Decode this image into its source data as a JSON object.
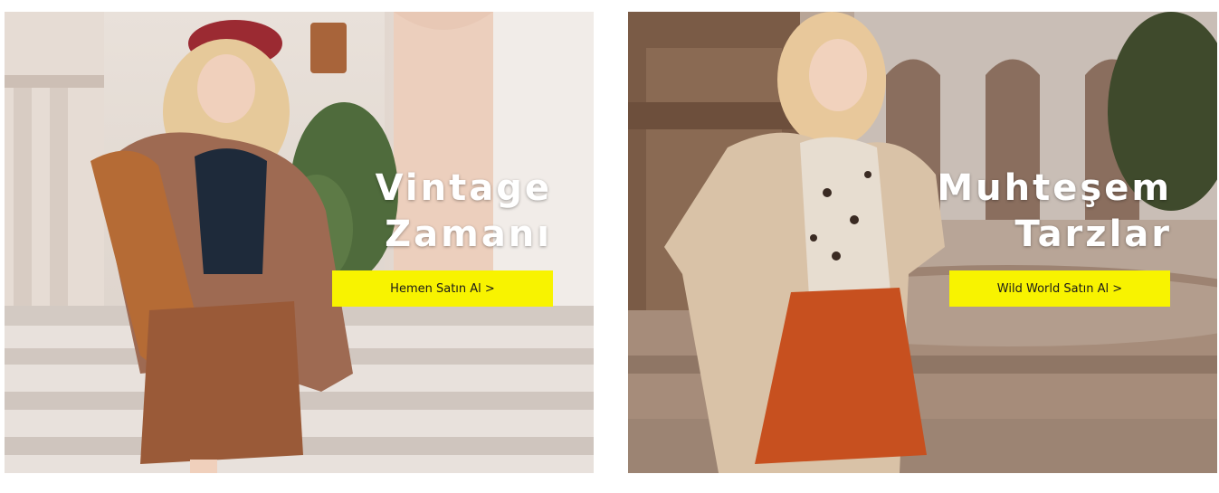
{
  "banners": [
    {
      "title_lines": [
        "Vintage",
        "Zamanı"
      ],
      "cta_label": "Hemen Satın Al >"
    },
    {
      "title_lines": [
        "Muhteşem",
        "Tarzlar"
      ],
      "cta_label": "Wild World Satın Al >"
    }
  ],
  "colors": {
    "cta_background": "#f8f300",
    "cta_text": "#1a1a1a",
    "headline_text": "#ffffff"
  }
}
